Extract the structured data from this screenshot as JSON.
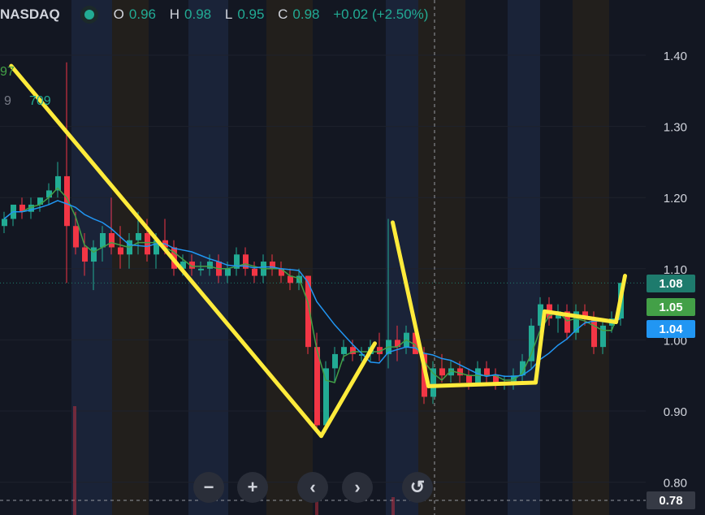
{
  "header": {
    "symbol": "NASDAQ",
    "o_label": "O",
    "o_value": "0.96",
    "h_label": "H",
    "h_value": "0.98",
    "l_label": "L",
    "l_value": "0.95",
    "c_label": "C",
    "c_value": "0.98",
    "change": "+0.02 (+2.50%)"
  },
  "legend": {
    "line1_value": "97",
    "line2_prefix": "9",
    "line2_value": "709"
  },
  "price_badges": [
    {
      "text": "1.08",
      "color": "#1e7b6d"
    },
    {
      "text": "1.05",
      "color": "#43a047"
    },
    {
      "text": "1.04",
      "color": "#2196f3"
    }
  ],
  "crosshair_label": "0.78",
  "navigation": {
    "zoom_out": "−",
    "zoom_in": "+",
    "scroll_left": "‹",
    "scroll_right": "›",
    "reset": "↺"
  },
  "colors": {
    "up": "#22ab94",
    "down": "#f23645",
    "ma_fast": "#43a047",
    "ma_slow": "#2196f3",
    "drawing": "#ffeb3b",
    "axis_text": "#d1d4dc"
  },
  "chart_data": {
    "type": "candlestick",
    "ylim": [
      0.78,
      1.45
    ],
    "yticks": [
      1.4,
      1.3,
      1.2,
      1.1,
      1.0,
      0.9,
      0.8
    ],
    "ytick_labels": [
      "1.40",
      "1.30",
      "1.20",
      "1.10",
      "1.00",
      "0.90",
      "0.80"
    ],
    "last_price": 1.08,
    "moving_averages": [
      {
        "value": 1.05
      },
      {
        "value": 1.04
      }
    ],
    "candles": [
      [
        1.16,
        1.18,
        1.15,
        1.17
      ],
      [
        1.17,
        1.19,
        1.16,
        1.19
      ],
      [
        1.19,
        1.2,
        1.17,
        1.18
      ],
      [
        1.18,
        1.2,
        1.17,
        1.19
      ],
      [
        1.19,
        1.2,
        1.18,
        1.2
      ],
      [
        1.2,
        1.22,
        1.19,
        1.21
      ],
      [
        1.21,
        1.25,
        1.2,
        1.23
      ],
      [
        1.23,
        1.39,
        1.08,
        1.16
      ],
      [
        1.16,
        1.18,
        1.12,
        1.13
      ],
      [
        1.13,
        1.15,
        1.09,
        1.11
      ],
      [
        1.11,
        1.14,
        1.07,
        1.13
      ],
      [
        1.13,
        1.16,
        1.11,
        1.15
      ],
      [
        1.15,
        1.2,
        1.12,
        1.13
      ],
      [
        1.13,
        1.16,
        1.1,
        1.12
      ],
      [
        1.12,
        1.15,
        1.1,
        1.14
      ],
      [
        1.14,
        1.18,
        1.12,
        1.15
      ],
      [
        1.15,
        1.17,
        1.11,
        1.12
      ],
      [
        1.12,
        1.15,
        1.1,
        1.14
      ],
      [
        1.14,
        1.17,
        1.12,
        1.13
      ],
      [
        1.13,
        1.14,
        1.09,
        1.1
      ],
      [
        1.1,
        1.12,
        1.09,
        1.11
      ],
      [
        1.11,
        1.12,
        1.09,
        1.1
      ],
      [
        1.1,
        1.11,
        1.09,
        1.1
      ],
      [
        1.1,
        1.12,
        1.09,
        1.11
      ],
      [
        1.11,
        1.12,
        1.08,
        1.09
      ],
      [
        1.09,
        1.11,
        1.08,
        1.1
      ],
      [
        1.1,
        1.13,
        1.09,
        1.12
      ],
      [
        1.12,
        1.13,
        1.09,
        1.1
      ],
      [
        1.1,
        1.11,
        1.08,
        1.09
      ],
      [
        1.09,
        1.12,
        1.08,
        1.11
      ],
      [
        1.11,
        1.12,
        1.09,
        1.1
      ],
      [
        1.1,
        1.11,
        1.08,
        1.09
      ],
      [
        1.09,
        1.1,
        1.07,
        1.08
      ],
      [
        1.08,
        1.1,
        1.07,
        1.09
      ],
      [
        1.09,
        1.09,
        0.98,
        0.99
      ],
      [
        0.99,
        1.01,
        0.87,
        0.88
      ],
      [
        0.88,
        0.97,
        0.87,
        0.96
      ],
      [
        0.96,
        0.99,
        0.94,
        0.98
      ],
      [
        0.98,
        1.0,
        0.97,
        0.99
      ],
      [
        0.99,
        1.0,
        0.97,
        0.98
      ],
      [
        0.98,
        0.99,
        0.97,
        0.98
      ],
      [
        0.98,
        1.0,
        0.97,
        0.99
      ],
      [
        0.99,
        1.01,
        0.97,
        0.98
      ],
      [
        0.98,
        1.17,
        0.96,
        1.0
      ],
      [
        1.0,
        1.02,
        0.97,
        0.99
      ],
      [
        0.99,
        1.02,
        0.98,
        1.01
      ],
      [
        1.01,
        1.03,
        0.98,
        0.98
      ],
      [
        0.98,
        0.99,
        0.91,
        0.92
      ],
      [
        0.92,
        0.97,
        0.91,
        0.96
      ],
      [
        0.96,
        0.98,
        0.94,
        0.95
      ],
      [
        0.95,
        0.97,
        0.94,
        0.96
      ],
      [
        0.96,
        0.97,
        0.94,
        0.95
      ],
      [
        0.95,
        0.96,
        0.93,
        0.94
      ],
      [
        0.94,
        0.97,
        0.94,
        0.96
      ],
      [
        0.96,
        0.97,
        0.94,
        0.95
      ],
      [
        0.95,
        0.96,
        0.93,
        0.94
      ],
      [
        0.94,
        0.95,
        0.93,
        0.94
      ],
      [
        0.94,
        0.96,
        0.93,
        0.95
      ],
      [
        0.95,
        0.98,
        0.94,
        0.97
      ],
      [
        0.97,
        1.03,
        0.96,
        1.02
      ],
      [
        1.02,
        1.06,
        1.01,
        1.05
      ],
      [
        1.05,
        1.06,
        1.02,
        1.03
      ],
      [
        1.03,
        1.05,
        1.01,
        1.04
      ],
      [
        1.04,
        1.05,
        1.0,
        1.01
      ],
      [
        1.01,
        1.05,
        1.0,
        1.04
      ],
      [
        1.04,
        1.05,
        1.02,
        1.03
      ],
      [
        1.03,
        1.04,
        0.98,
        0.99
      ],
      [
        0.99,
        1.03,
        0.98,
        1.02
      ],
      [
        1.02,
        1.04,
        1.01,
        1.03
      ],
      [
        1.03,
        1.08,
        1.02,
        1.08
      ]
    ],
    "drawing_lines": [
      [
        [
          0.8,
          1.385
        ],
        [
          35.5,
          0.865
        ]
      ],
      [
        [
          35.5,
          0.865
        ],
        [
          41.5,
          0.995
        ]
      ],
      [
        [
          43.5,
          1.165
        ],
        [
          47.5,
          0.935
        ]
      ],
      [
        [
          47.5,
          0.935
        ],
        [
          59.5,
          0.94
        ]
      ],
      [
        [
          59.5,
          0.94
        ],
        [
          60.5,
          1.04
        ]
      ],
      [
        [
          60.5,
          1.04
        ],
        [
          68.5,
          1.025
        ]
      ],
      [
        [
          68.5,
          1.025
        ],
        [
          69.5,
          1.09
        ]
      ]
    ]
  }
}
